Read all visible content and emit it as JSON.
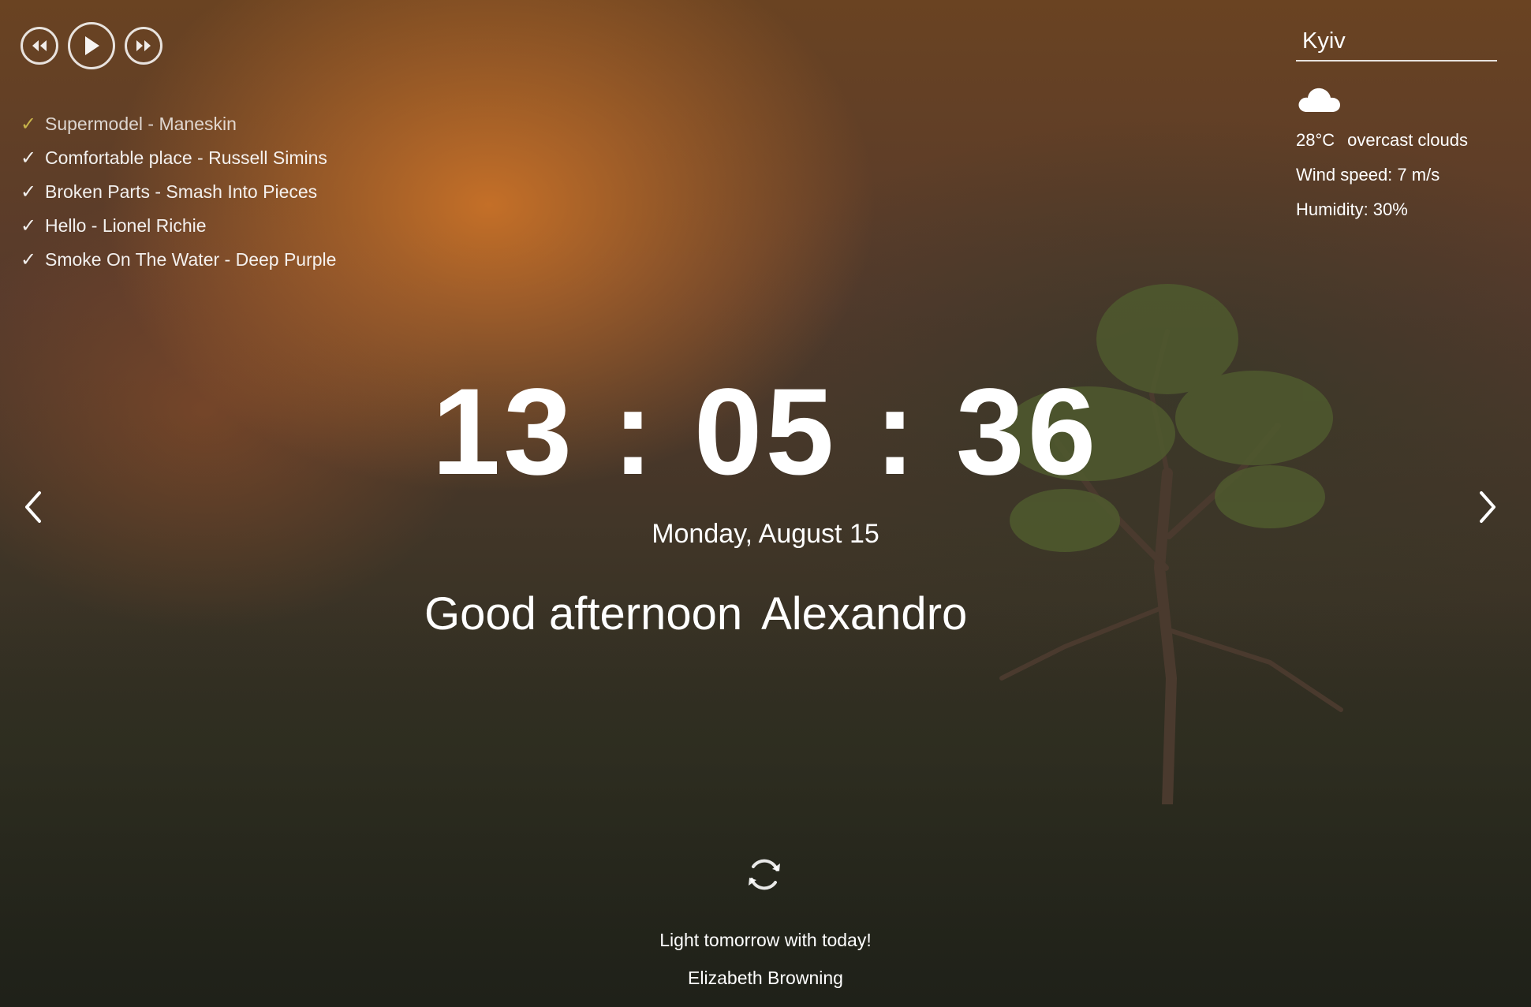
{
  "player": {
    "icons": {
      "prev": "rewind-icon",
      "play": "play-icon",
      "next": "fast-forward-icon"
    },
    "playlist": [
      {
        "title": "Supermodel - Maneskin",
        "active": true
      },
      {
        "title": "Comfortable place - Russell Simins",
        "active": false
      },
      {
        "title": "Broken Parts - Smash Into Pieces",
        "active": false
      },
      {
        "title": "Hello - Lionel Richie",
        "active": false
      },
      {
        "title": "Smoke On The Water - Deep Purple",
        "active": false
      }
    ],
    "check_glyph": "✓",
    "active_color": "#c7b34a"
  },
  "weather": {
    "city": "Kyiv",
    "icon": "cloud-icon",
    "temperature": "28°C",
    "description": "overcast clouds",
    "wind": "Wind speed: 7 m/s",
    "humidity": "Humidity: 30%"
  },
  "clock": {
    "time": "13 : 05 : 36",
    "date": "Monday, August 15"
  },
  "greeting": {
    "text": "Good afternoon",
    "name": "Alexandro"
  },
  "slider": {
    "prev_icon": "chevron-left-icon",
    "next_icon": "chevron-right-icon"
  },
  "quote": {
    "refresh_icon": "refresh-icon",
    "text": "Light tomorrow with today!",
    "author": "Elizabeth Browning"
  }
}
